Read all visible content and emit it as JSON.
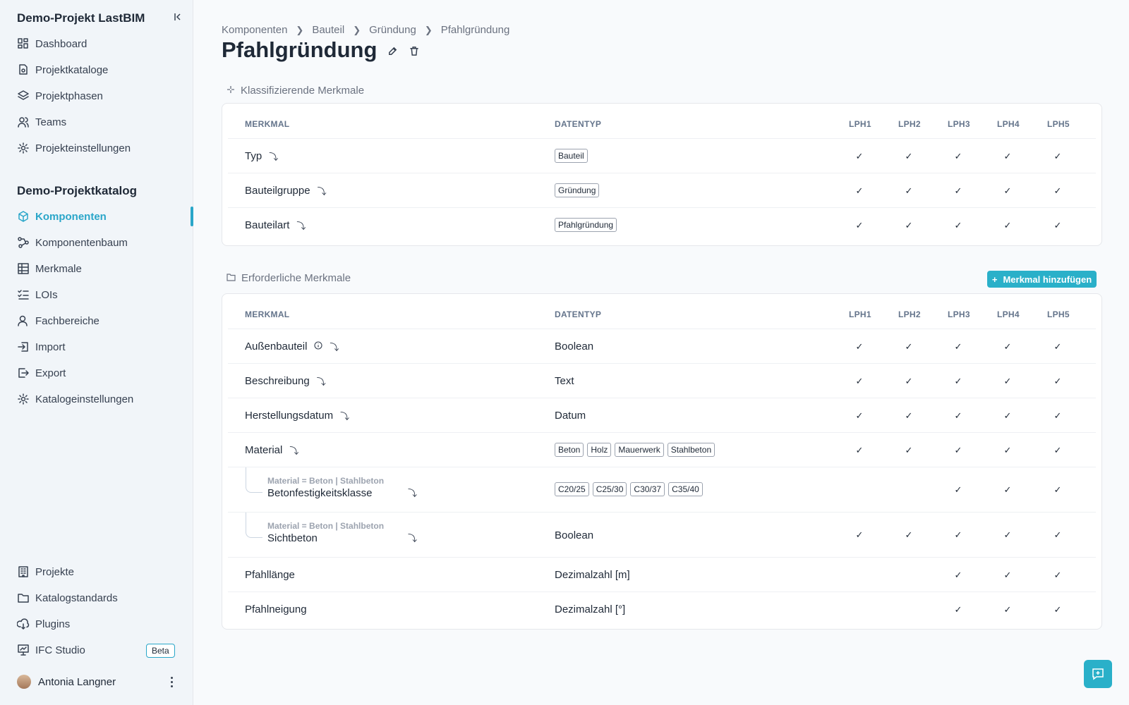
{
  "sidebar": {
    "project_title": "Demo-Projekt LastBIM",
    "catalog_title": "Demo-Projektkatalog",
    "project_items": [
      {
        "label": "Dashboard",
        "icon": "dashboard-icon"
      },
      {
        "label": "Projektkataloge",
        "icon": "catalog-icon"
      },
      {
        "label": "Projektphasen",
        "icon": "layers-icon"
      },
      {
        "label": "Teams",
        "icon": "users-icon"
      },
      {
        "label": "Projekteinstellungen",
        "icon": "gear-icon"
      }
    ],
    "catalog_items": [
      {
        "label": "Komponenten",
        "icon": "cube-icon",
        "active": true
      },
      {
        "label": "Komponentenbaum",
        "icon": "tree-icon"
      },
      {
        "label": "Merkmale",
        "icon": "table-icon"
      },
      {
        "label": "LOIs",
        "icon": "checklist-icon"
      },
      {
        "label": "Fachbereiche",
        "icon": "user-icon"
      },
      {
        "label": "Import",
        "icon": "import-icon"
      },
      {
        "label": "Export",
        "icon": "export-icon"
      },
      {
        "label": "Katalogeinstellungen",
        "icon": "gear-icon"
      }
    ],
    "bottom_items": [
      {
        "label": "Projekte",
        "icon": "building-icon"
      },
      {
        "label": "Katalogstandards",
        "icon": "folder-icon"
      },
      {
        "label": "Plugins",
        "icon": "cloud-download-icon"
      },
      {
        "label": "IFC Studio",
        "icon": "monitor-icon"
      }
    ],
    "beta_badge": "Beta",
    "user_name": "Antonia Langner"
  },
  "breadcrumb": [
    "Komponenten",
    "Bauteil",
    "Gründung",
    "Pfahlgründung"
  ],
  "page_title": "Pfahlgründung",
  "columns": {
    "merkmal": "MERKMAL",
    "datentyp": "DATENTYP",
    "phases": [
      "LPH1",
      "LPH2",
      "LPH3",
      "LPH4",
      "LPH5"
    ]
  },
  "classifying": {
    "title": "Klassifizierende Merkmale",
    "rows": [
      {
        "name": "Typ",
        "tags": [
          "Bauteil"
        ],
        "checks": [
          true,
          true,
          true,
          true,
          true
        ]
      },
      {
        "name": "Bauteilgruppe",
        "tags": [
          "Gründung"
        ],
        "checks": [
          true,
          true,
          true,
          true,
          true
        ]
      },
      {
        "name": "Bauteilart",
        "tags": [
          "Pfahlgründung"
        ],
        "checks": [
          true,
          true,
          true,
          true,
          true
        ]
      }
    ]
  },
  "required": {
    "title": "Erforderliche Merkmale",
    "add_button": "Merkmal hinzufügen",
    "rows": [
      {
        "name": "Außenbauteil",
        "info": true,
        "type": "Boolean",
        "checks": [
          true,
          true,
          true,
          true,
          true
        ]
      },
      {
        "name": "Beschreibung",
        "type": "Text",
        "checks": [
          true,
          true,
          true,
          true,
          true
        ]
      },
      {
        "name": "Herstellungsdatum",
        "type": "Datum",
        "checks": [
          true,
          true,
          true,
          true,
          true
        ]
      },
      {
        "name": "Material",
        "tags": [
          "Beton",
          "Holz",
          "Mauerwerk",
          "Stahlbeton"
        ],
        "checks": [
          true,
          true,
          true,
          true,
          true
        ]
      },
      {
        "name": "Betonfestigkeitsklasse",
        "condition": "Material = Beton | Stahlbeton",
        "tags": [
          "C20/25",
          "C25/30",
          "C30/37",
          "C35/40"
        ],
        "checks": [
          false,
          false,
          true,
          true,
          true
        ]
      },
      {
        "name": "Sichtbeton",
        "condition": "Material = Beton | Stahlbeton",
        "type": "Boolean",
        "checks": [
          true,
          true,
          true,
          true,
          true
        ]
      },
      {
        "name": "Pfahllänge",
        "type": "Dezimalzahl [m]",
        "checks": [
          false,
          false,
          true,
          true,
          true
        ],
        "no_arrow": true
      },
      {
        "name": "Pfahlneigung",
        "type": "Dezimalzahl [°]",
        "checks": [
          false,
          false,
          true,
          true,
          true
        ],
        "no_arrow": true
      }
    ]
  },
  "symbols": {
    "check": "✓",
    "arrow": "⤵",
    "plus": "+"
  },
  "colors": {
    "accent": "#2aa6c9",
    "button": "#2ab0c9"
  }
}
